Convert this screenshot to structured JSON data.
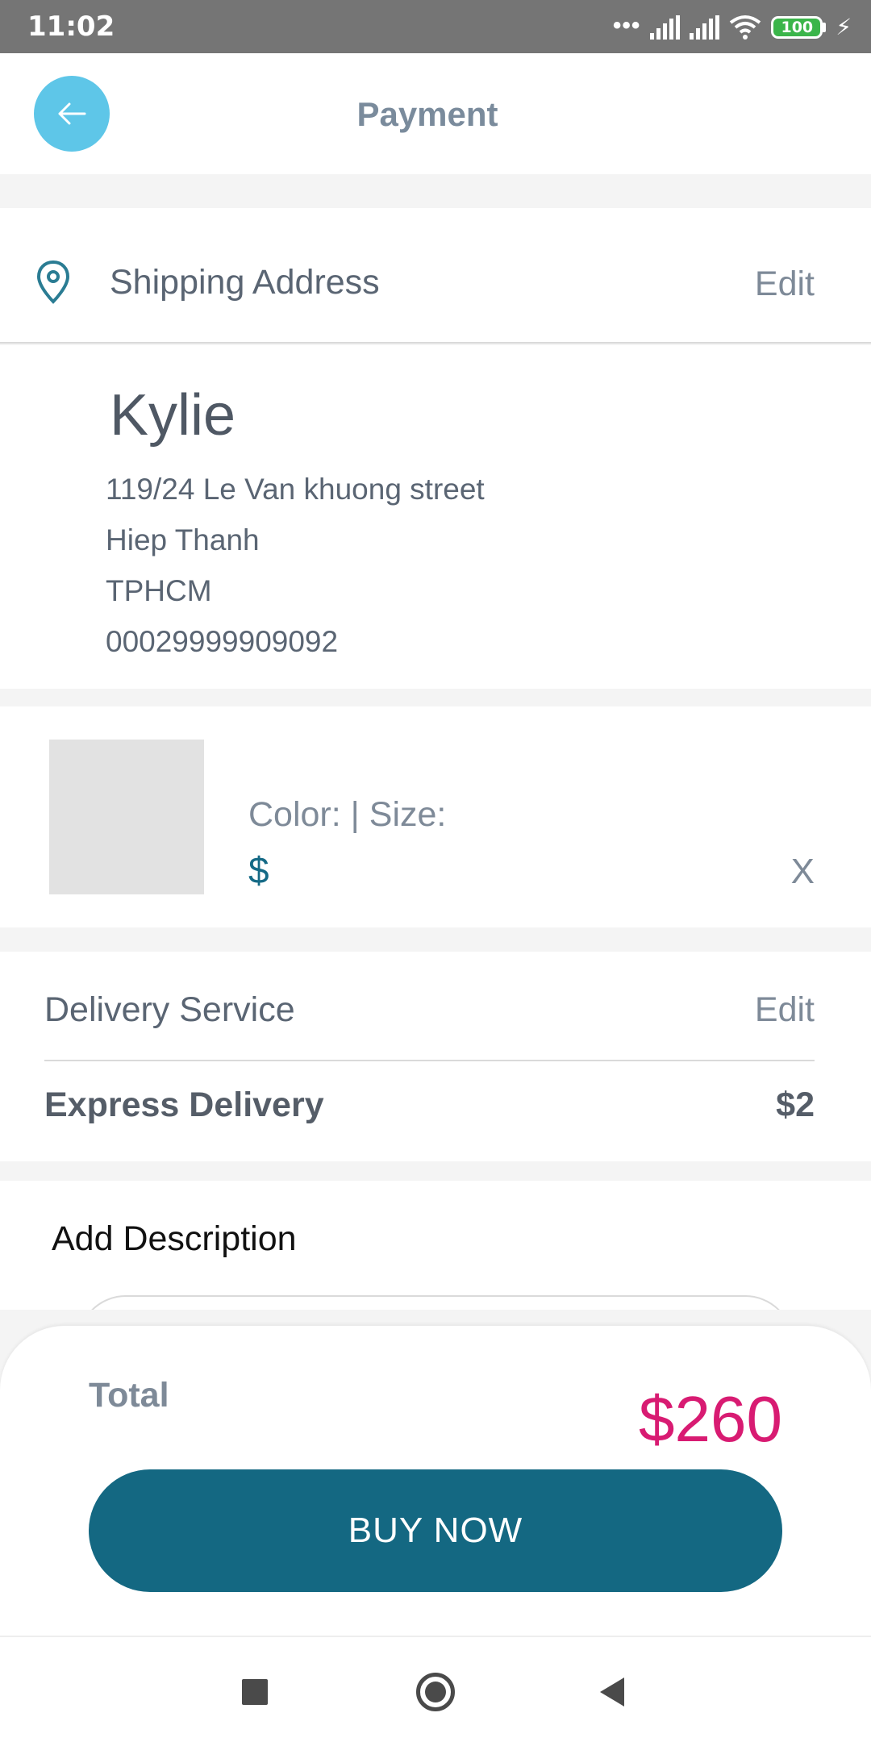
{
  "status_bar": {
    "time": "11:02",
    "dots": "•••",
    "battery": "100",
    "charging_icon": "bolt-icon"
  },
  "header": {
    "title": "Payment",
    "back_icon": "arrow-left-icon",
    "accent": "#5ec6e8"
  },
  "shipping": {
    "label": "Shipping Address",
    "edit_label": "Edit",
    "icon": "location-pin-icon",
    "name": "Kylie",
    "lines": [
      "119/24 Le Van khuong street",
      "Hiep Thanh",
      "TPHCM",
      "00029999909092"
    ]
  },
  "product": {
    "variant": "Color:  | Size:",
    "price": "$",
    "remove_label": "X"
  },
  "delivery": {
    "label": "Delivery Service",
    "edit_label": "Edit",
    "option": "Express Delivery",
    "price": "$2"
  },
  "description": {
    "label": "Add Description"
  },
  "total": {
    "label": "Total",
    "amount": "$260",
    "amount_color": "#d81b72",
    "buy_label": "BUY NOW",
    "button_color": "#146882"
  }
}
